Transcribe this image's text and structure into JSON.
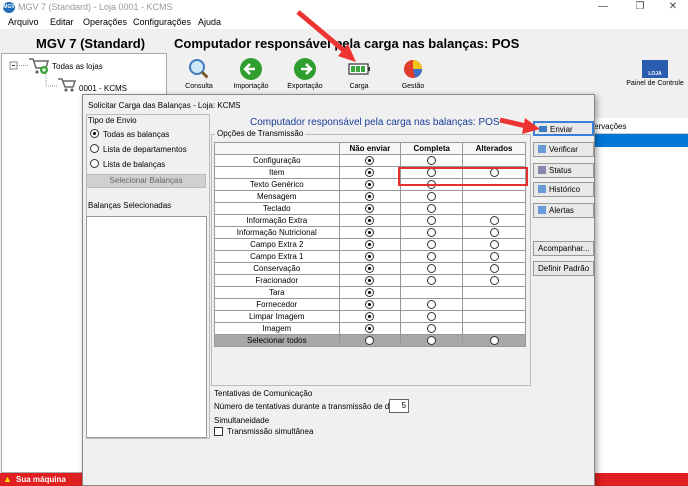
{
  "window": {
    "title": "MGV 7 (Standard) - Loja 0001 - KCMS",
    "app_icon_text": "MGV",
    "min": "—",
    "max": "❐",
    "close": "✕"
  },
  "menu": [
    "Arquivo",
    "Editar",
    "Operações",
    "Configurações",
    "Ajuda"
  ],
  "header": {
    "app_name": "MGV 7 (Standard)",
    "title": "Computador responsável pela carga nas balanças: POS"
  },
  "tree": {
    "root": "Todas as lojas",
    "child": "0001 - KCMS"
  },
  "toolbar": {
    "consulta": "Consulta",
    "importacao": "Importação",
    "exportacao": "Exportação",
    "carga": "Carga",
    "gestao": "Gestão",
    "painel": "Painel de Controle",
    "store_icon": "LOJA"
  },
  "right_list": {
    "header": "ervações"
  },
  "status": {
    "text": "Sua máquina"
  },
  "dialog": {
    "title": "Solicitar Carga das Balanças - Loja: KCMS",
    "tipo_envio": "Tipo de Envio",
    "radios": [
      "Todas as balanças",
      "Lista de departamentos",
      "Lista de balanças"
    ],
    "select_button": "Selecionar Balanças",
    "selected_label": "Balanças Selecionadas",
    "header": "Computador responsável pela carga nas balanças: POS",
    "options_title": "Opções de Transmissão",
    "columns": [
      "Não enviar",
      "Completa",
      "Alterados"
    ],
    "rows": [
      "Configuração",
      "Item",
      "Texto Genérico",
      "Mensagem",
      "Teclado",
      "Informação Extra",
      "Informação Nutricional",
      "Campo Extra 2",
      "Campo Extra 1",
      "Conservação",
      "Fracionador",
      "Tara",
      "Fornecedor",
      "Limpar Imagem",
      "Imagem"
    ],
    "select_all": "Selecionar todos",
    "buttons": {
      "enviar": "Enviar",
      "verificar": "Verificar",
      "status": "Status",
      "historico": "Histórico",
      "alertas": "Alertas",
      "acompanhar": "Acompanhar...",
      "definir": "Definir Padrão"
    },
    "tentativas_title": "Tentativas de Comunicação",
    "tentativas_label": "Número de tentativas durante a transmissão de dados",
    "tentativas_value": "5",
    "simultaneidade_title": "Simultaneidade",
    "simultaneidade_label": "Transmissão simultânea"
  }
}
